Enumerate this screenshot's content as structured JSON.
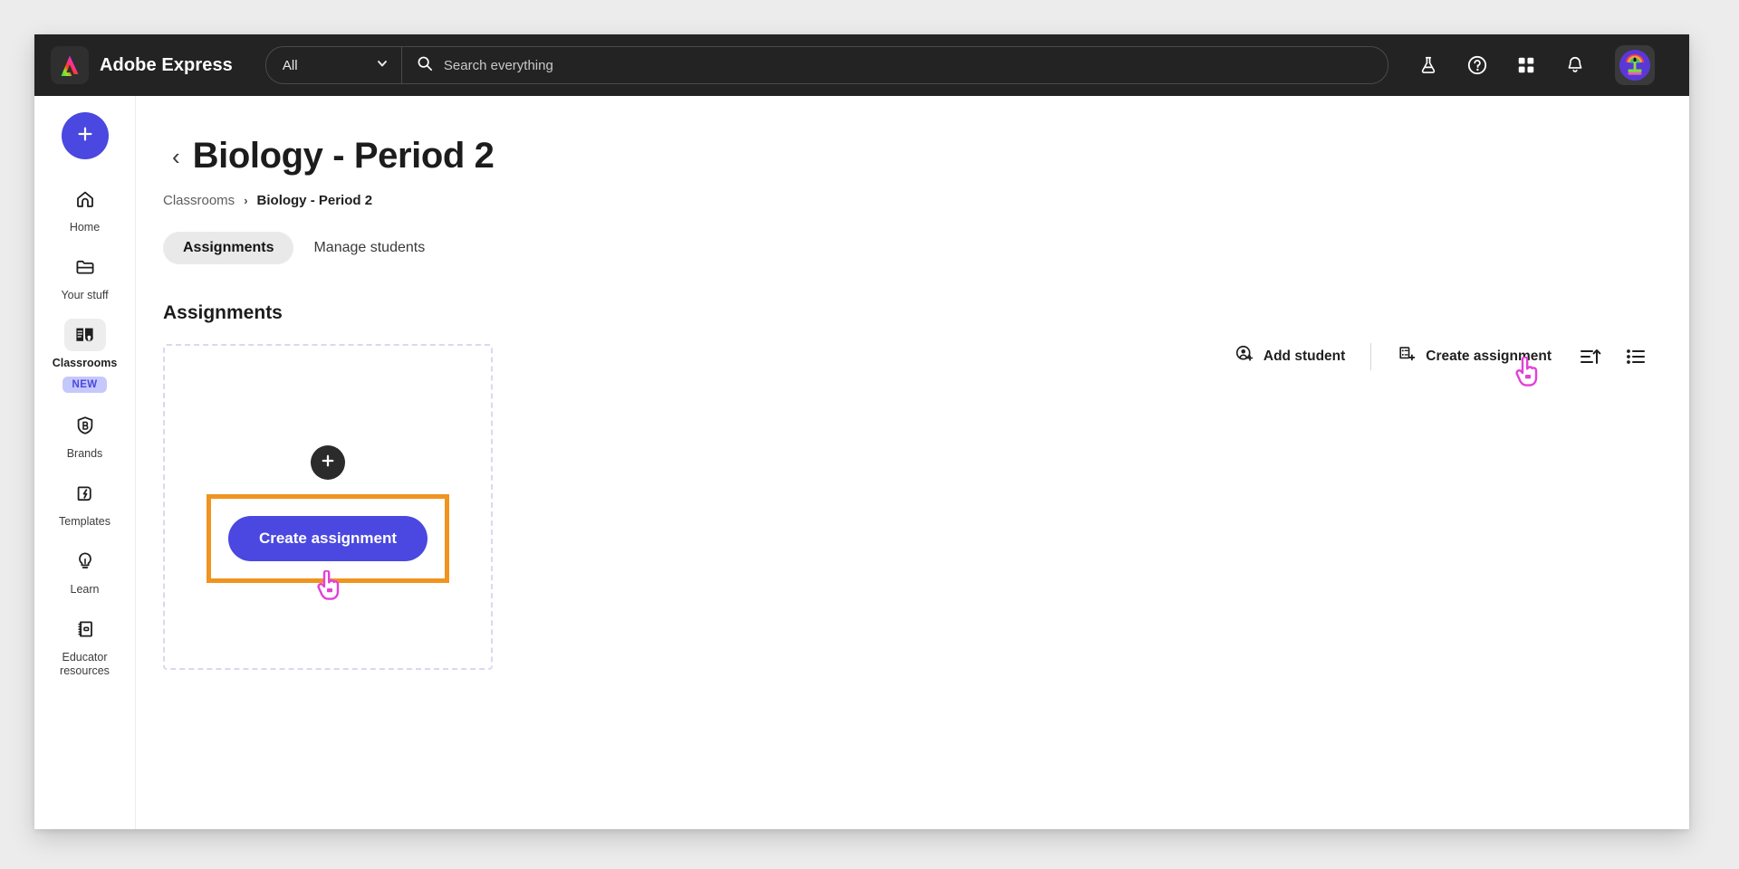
{
  "topbar": {
    "logo_icon": "adobe-express-logo-icon",
    "brand_name": "Adobe Express",
    "scope_value": "All",
    "scope_chevron_icon": "chevron-down-icon",
    "search_icon": "search-icon",
    "search_placeholder": "Search everything",
    "actions": [
      {
        "name": "beaker-icon",
        "label": "Labs"
      },
      {
        "name": "help-icon",
        "label": "Help"
      },
      {
        "name": "apps-grid-icon",
        "label": "Apps"
      },
      {
        "name": "bell-icon",
        "label": "Notifications"
      }
    ],
    "avatar_icon": "avatar"
  },
  "sidebar": {
    "create_button_icon": "plus-icon",
    "items": [
      {
        "label": "Home",
        "icon": "home-icon",
        "active": false,
        "badge": ""
      },
      {
        "label": "Your stuff",
        "icon": "folder-icon",
        "active": false,
        "badge": ""
      },
      {
        "label": "Classrooms",
        "icon": "classroom-icon",
        "active": true,
        "badge": "NEW"
      },
      {
        "label": "Brands",
        "icon": "brand-shield-icon",
        "active": false,
        "badge": ""
      },
      {
        "label": "Templates",
        "icon": "templates-icon",
        "active": false,
        "badge": ""
      },
      {
        "label": "Learn",
        "icon": "lightbulb-icon",
        "active": false,
        "badge": ""
      },
      {
        "label": "Educator resources",
        "icon": "notebook-icon",
        "active": false,
        "badge": ""
      }
    ]
  },
  "main": {
    "back_chevron_icon": "chevron-left-icon",
    "page_title": "Biology - Period 2",
    "breadcrumb": {
      "root": "Classrooms",
      "separator": "›",
      "current": "Biology - Period 2"
    },
    "tabs": [
      {
        "label": "Assignments",
        "active": true
      },
      {
        "label": "Manage students",
        "active": false
      }
    ],
    "toolbar": {
      "add_student_label": "Add student",
      "add_student_icon": "add-person-icon",
      "create_assignment_label": "Create assignment",
      "create_assignment_icon": "document-plus-icon",
      "sort_icon": "sort-ascending-icon",
      "view_icon": "list-view-icon"
    },
    "section_title": "Assignments",
    "dropzone": {
      "plus_icon": "plus-icon",
      "cta_label": "Create assignment",
      "highlight_color": "#f0941f"
    }
  },
  "colors": {
    "accent_blue": "#4a48e0",
    "topbar_bg": "#232323",
    "highlight_orange": "#f0941f",
    "cursor_magenta": "#e040d8",
    "badge_bg": "#c5c8fa"
  }
}
